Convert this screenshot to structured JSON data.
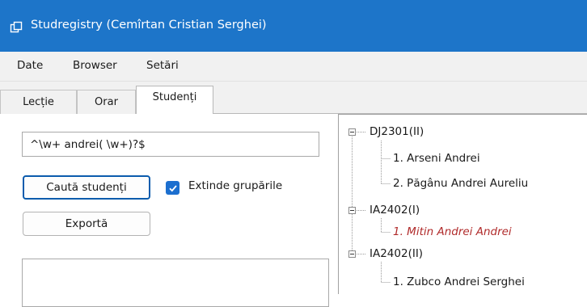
{
  "window": {
    "title": "Studregistry (Cemîrtan Cristian Serghei)"
  },
  "menu": {
    "items": [
      "Date",
      "Browser",
      "Setări"
    ]
  },
  "tabs": [
    {
      "label": "Lecție",
      "active": false
    },
    {
      "label": "Orar",
      "active": false
    },
    {
      "label": "Studenți",
      "active": true
    }
  ],
  "search": {
    "value": "^\\w+ andrei( \\w+)?$"
  },
  "buttons": {
    "search": "Caută studenți",
    "export": "Exportă"
  },
  "expand_groups": {
    "label": "Extinde grupările",
    "checked": true
  },
  "tree": {
    "groups": [
      {
        "name": "DJ2301(II)",
        "students": [
          {
            "label": "1. Arseni Andrei"
          },
          {
            "label": "2. Păgânu Andrei Aureliu"
          }
        ]
      },
      {
        "name": "IA2402(I)",
        "students": [
          {
            "label": "1. Mitin Andrei Andrei",
            "highlighted": true
          }
        ]
      },
      {
        "name": "IA2402(II)",
        "students": [
          {
            "label": "1. Zubco Andrei Serghei"
          }
        ]
      }
    ]
  },
  "colors": {
    "titlebar": "#1d75c9",
    "accent": "#1c6fcf",
    "highlight_text": "#b02a2a"
  }
}
